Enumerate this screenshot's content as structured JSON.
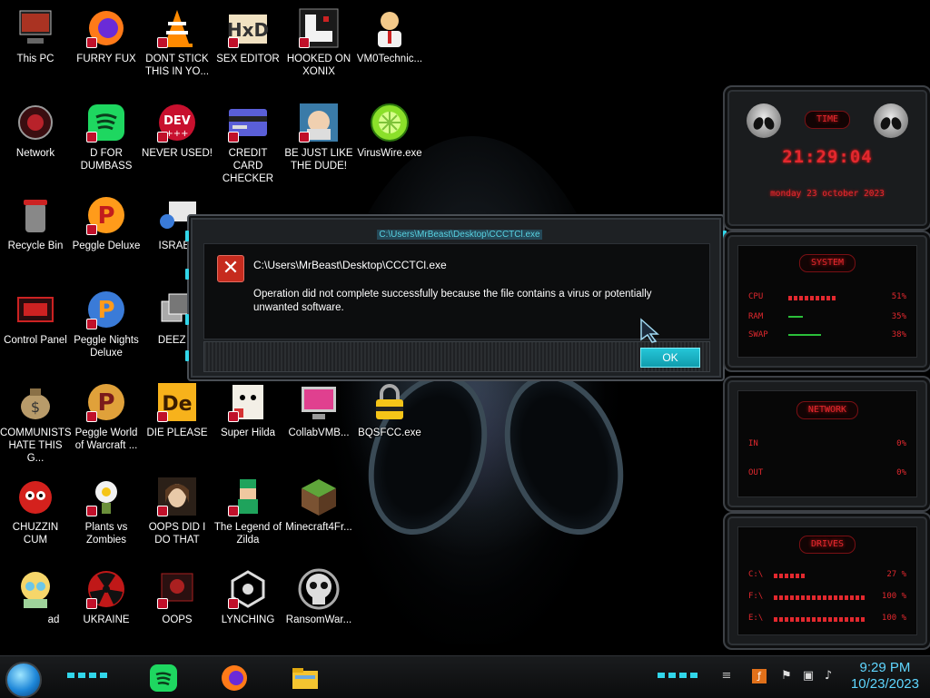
{
  "desktop": {
    "icons": [
      {
        "label": "This PC",
        "icon": "this-pc-icon"
      },
      {
        "label": "FURRY FUX",
        "icon": "firefox-icon"
      },
      {
        "label": "DONT STICK THIS IN YO...",
        "icon": "vlc-cone-icon"
      },
      {
        "label": "SEX EDITOR",
        "icon": "hxd-editor-icon"
      },
      {
        "label": "HOOKED ON XONIX",
        "icon": "xonix-icon"
      },
      {
        "label": "VM0Technic...",
        "icon": "technician-icon"
      },
      {
        "label": "Network",
        "icon": "network-icon"
      },
      {
        "label": "D FOR DUMBASS",
        "icon": "spotify-icon"
      },
      {
        "label": "NEVER USED!",
        "icon": "dev-cpp-icon"
      },
      {
        "label": "CREDIT CARD CHECKER",
        "icon": "credit-card-icon"
      },
      {
        "label": "BE JUST LIKE THE DUDE!",
        "icon": "dude-icon"
      },
      {
        "label": "VirusWire.exe",
        "icon": "limewire-icon"
      },
      {
        "label": "Recycle Bin",
        "icon": "recycle-bin-icon"
      },
      {
        "label": "Peggle Deluxe",
        "icon": "peggle-icon"
      },
      {
        "label": "ISRAEL",
        "icon": "israel-icon"
      },
      {
        "label": "Control Panel",
        "icon": "control-panel-icon"
      },
      {
        "label": "Peggle Nights Deluxe",
        "icon": "peggle-nights-icon"
      },
      {
        "label": "DEEZ N",
        "icon": "deez-icon"
      },
      {
        "label": "COMMUNISTS HATE THIS G...",
        "icon": "money-bag-icon"
      },
      {
        "label": "Peggle World of Warcraft ...",
        "icon": "peggle-wow-icon"
      },
      {
        "label": "DIE PLEASE",
        "icon": "die-icon"
      },
      {
        "label": "Super Hilda",
        "icon": "super-hilda-icon"
      },
      {
        "label": "CollabVMB...",
        "icon": "collabvm-icon"
      },
      {
        "label": "BQSFCC.exe",
        "icon": "lock-icon"
      },
      {
        "label": "CHUZZIN CUM",
        "icon": "chuzzle-icon"
      },
      {
        "label": "Plants vs Zombies",
        "icon": "pvz-icon"
      },
      {
        "label": "OOPS DID I DO THAT",
        "icon": "portrait-icon"
      },
      {
        "label": "The Legend of Zilda",
        "icon": "zelda-icon"
      },
      {
        "label": "Minecraft4Fr...",
        "icon": "minecraft-icon"
      },
      {
        "label": "ad",
        "icon": "character-icon"
      },
      {
        "label": "UKRAINE",
        "icon": "radiation-icon"
      },
      {
        "label": "OOPS",
        "icon": "oops-icon"
      },
      {
        "label": "LYNCHING",
        "icon": "lynching-icon"
      },
      {
        "label": "RansomWar...",
        "icon": "skull-icon"
      }
    ]
  },
  "dialog": {
    "title": "C:\\Users\\MrBeast\\Desktop\\CCCTCl.exe",
    "message_title": "C:\\Users\\MrBeast\\Desktop\\CCCTCl.exe",
    "message": "Operation did not complete successfully because the file contains a virus or potentially unwanted software.",
    "ok_label": "OK",
    "error_icon": "error-x-icon"
  },
  "widgets": {
    "time": {
      "header": "TIME",
      "time": "21:29:04",
      "date": "monday 23 october 2023"
    },
    "system": {
      "header": "SYSTEM",
      "rows": [
        {
          "key": "CPU",
          "value": "51%",
          "level": 0.51
        },
        {
          "key": "RAM",
          "value": "35%",
          "level": 0.35
        },
        {
          "key": "SWAP",
          "value": "38%",
          "level": 0.38
        }
      ]
    },
    "network": {
      "header": "NETWORK",
      "rows": [
        {
          "key": "IN",
          "value": "0%"
        },
        {
          "key": "OUT",
          "value": "0%"
        }
      ]
    },
    "drives": {
      "header": "DRIVES",
      "rows": [
        {
          "key": "C:\\",
          "value": "27 %",
          "level": 0.27
        },
        {
          "key": "F:\\",
          "value": "100 %",
          "level": 1.0
        },
        {
          "key": "E:\\",
          "value": "100 %",
          "level": 1.0
        }
      ]
    }
  },
  "taskbar": {
    "start_icon": "start-orb-icon",
    "apps": [
      "spotify-icon",
      "firefox-icon",
      "file-explorer-icon"
    ],
    "tray": [
      "flash-icon",
      "security-flag-icon",
      "network-tray-icon",
      "volume-icon"
    ],
    "clock_time": "9:29 PM",
    "clock_date": "10/23/2023"
  },
  "colors": {
    "accent_cyan": "#32d6ea",
    "widget_red": "#e2282e",
    "error_red": "#c62b1e",
    "clock_blue": "#5fd6ff"
  }
}
